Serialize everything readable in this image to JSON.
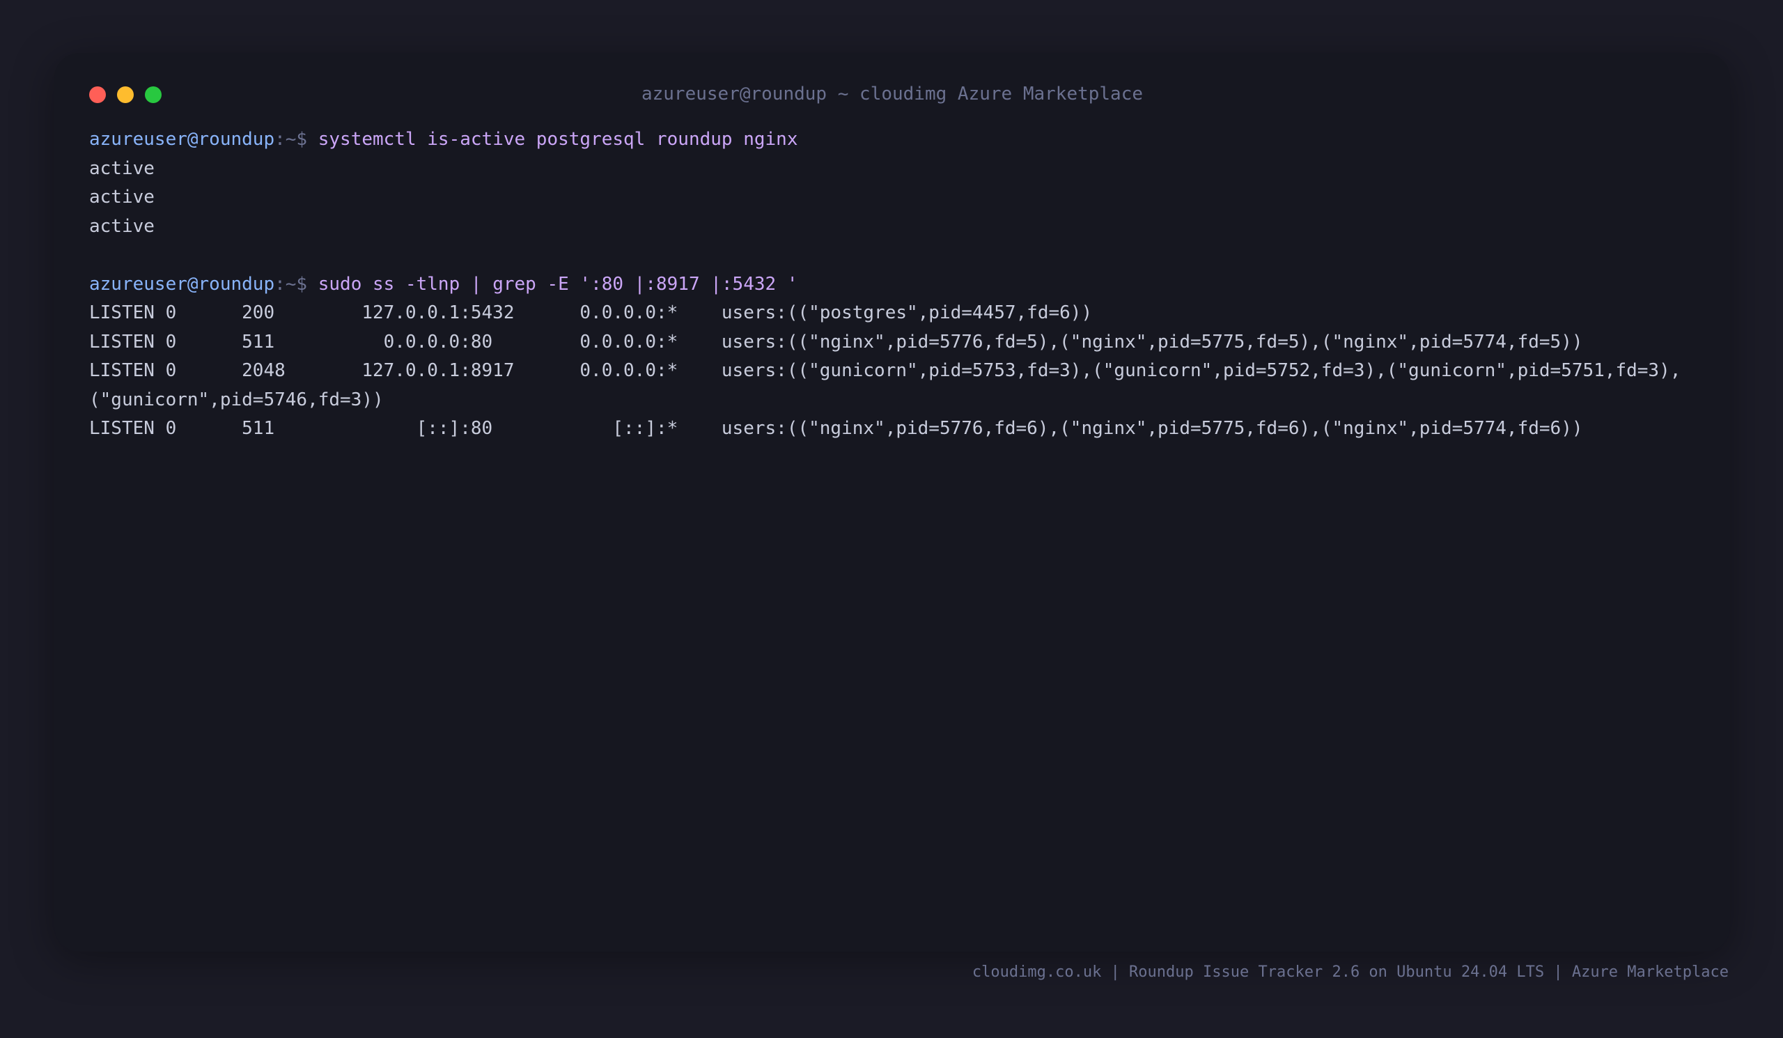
{
  "window": {
    "title": "azureuser@roundup ~ cloudimg Azure Marketplace"
  },
  "colors": {
    "background": "#1b1b26",
    "terminal_bg": "#161720",
    "prompt_user": "#89b4fa",
    "prompt_path": "#6b7190",
    "command": "#cba6f7",
    "output": "#c8ccdc",
    "close": "#ff5f57",
    "minimize": "#febc2e",
    "maximize": "#28c840"
  },
  "terminal": {
    "session1": {
      "prompt_user": "azureuser@roundup",
      "prompt_path": ":~$ ",
      "command": "systemctl is-active postgresql roundup nginx",
      "output": [
        "active",
        "active",
        "active"
      ]
    },
    "session2": {
      "prompt_user": "azureuser@roundup",
      "prompt_path": ":~$ ",
      "command": "sudo ss -tlnp | grep -E ':80 |:8917 |:5432 '",
      "output": [
        "LISTEN 0      200        127.0.0.1:5432      0.0.0.0:*    users:((\"postgres\",pid=4457,fd=6))",
        "LISTEN 0      511          0.0.0.0:80        0.0.0.0:*    users:((\"nginx\",pid=5776,fd=5),(\"nginx\",pid=5775,fd=5),(\"nginx\",pid=5774,fd=5))",
        "LISTEN 0      2048       127.0.0.1:8917      0.0.0.0:*    users:((\"gunicorn\",pid=5753,fd=3),(\"gunicorn\",pid=5752,fd=3),(\"gunicorn\",pid=5751,fd=3),(\"gunicorn\",pid=5746,fd=3))",
        "LISTEN 0      511             [::]:80           [::]:*    users:((\"nginx\",pid=5776,fd=6),(\"nginx\",pid=5775,fd=6),(\"nginx\",pid=5774,fd=6))"
      ]
    }
  },
  "footer": {
    "text": "cloudimg.co.uk | Roundup Issue Tracker 2.6 on Ubuntu 24.04 LTS | Azure Marketplace"
  }
}
